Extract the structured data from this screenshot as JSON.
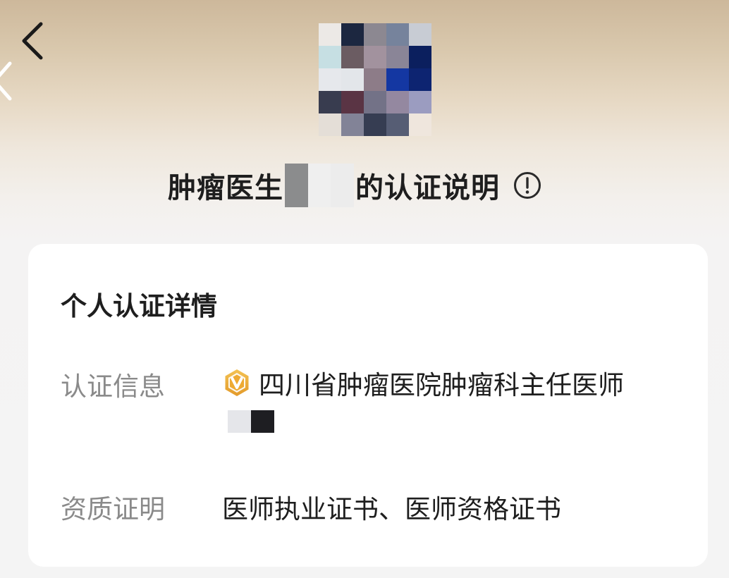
{
  "header": {
    "back_icon": "chevron-left-icon",
    "title_prefix": "肿瘤医生",
    "title_suffix": "的认证说明",
    "info_icon": "info-circle-icon",
    "avatar_pixels": [
      "#ece9e6",
      "#1c2740",
      "#8c8891",
      "#76839c",
      "#c8ccd4",
      "#c6dfe3",
      "#6b5c62",
      "#a2929e",
      "#8a8597",
      "#0b1f5e",
      "#e6e8ec",
      "#e3e6ea",
      "#8d7c88",
      "#1437a2",
      "#0d2471",
      "#383c4f",
      "#5a3444",
      "#737287",
      "#9488a0",
      "#9b9cc0",
      "#e4ded7",
      "#828397",
      "#363d52",
      "#565d74",
      "#efe6dd"
    ],
    "title_name_pixels": [
      "#8b8c8d",
      "#efefef",
      "#ececec"
    ]
  },
  "card": {
    "title": "个人认证详情",
    "rows": [
      {
        "label": "认证信息",
        "value": "四川省肿瘤医院肿瘤科主任医师",
        "icon": "verified-v-badge-icon",
        "icon_color": "#e9a936",
        "redacted_pixels": [
          "#e5e6ea",
          "#1e1e22"
        ]
      },
      {
        "label": "资质证明",
        "value": "医师执业证书、医师资格证书"
      }
    ]
  },
  "colors": {
    "header_gradient_top": "#cdb89b",
    "page_background": "#f4f4f4",
    "card_background": "#ffffff",
    "primary_text": "#1e1e1e",
    "secondary_text": "#8a8a8a"
  }
}
